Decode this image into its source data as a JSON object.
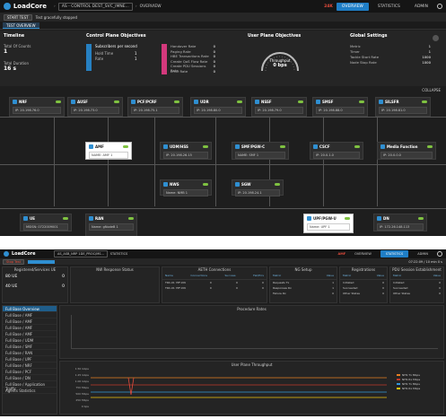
{
  "app": {
    "name": "LoadCore"
  },
  "s1": {
    "breadcrumb": {
      "session": "AS - CONTROL DEST_SVC_IMNE...",
      "page": "OVERVIEW"
    },
    "topright": {
      "alerts": "24K",
      "tabs": [
        "OVERVIEW",
        "STATISTICS",
        "ADMIN"
      ]
    },
    "subbar": {
      "button": "START TEST",
      "status": "Test gracefully stopped"
    },
    "tab": "TEST OVERVIEW",
    "timeline": {
      "title": "Timeline",
      "loops_label": "Total Of Counts",
      "loops": "1",
      "duration_label": "Total Duration",
      "duration": "16 s"
    },
    "cp": {
      "title": "Control Plane Objectives",
      "subs_label": "Subscribers per second",
      "hold_label": "Hold Time",
      "hold": "1",
      "rate_label": "Rate",
      "rate": "1",
      "rows": [
        {
          "k": "Handover Rate",
          "v": "0"
        },
        {
          "k": "Paging Rate",
          "v": "0"
        },
        {
          "k": "HBE Transactions Rate",
          "v": "0"
        },
        {
          "k": "Create QoS Flow Rate",
          "v": "0"
        },
        {
          "k": "Create PDU Sessions Rate",
          "v": "0"
        },
        {
          "k": "Error Rate",
          "v": "0"
        }
      ]
    },
    "up": {
      "title": "User Plane Objectives",
      "gauge_label": "Throughput",
      "gauge_value": "0 bps"
    },
    "gs": {
      "title": "Global Settings",
      "rows": [
        {
          "k": "Metric",
          "v": "1"
        },
        {
          "k": "Timer",
          "v": "1"
        },
        {
          "k": "Tackle Start Rate",
          "v": "1000"
        },
        {
          "k": "Node Stop Rate",
          "v": "1000"
        }
      ]
    },
    "collapse": "COLLAPSE",
    "nfs": [
      {
        "name": "NRF",
        "ip": "IP: 20.198.76.0"
      },
      {
        "name": "AUSF",
        "ip": "IP: 20.198.73.0"
      },
      {
        "name": "PCF/PCRF",
        "ip": "IP: 20.198.75.1"
      },
      {
        "name": "UDR",
        "ip": "IP: 20.198.80.0"
      },
      {
        "name": "NSSF",
        "ip": "IP: 20.198.79.0"
      },
      {
        "name": "SMSF",
        "ip": "IP: 20.198.88.0"
      },
      {
        "name": "SILSFR",
        "ip": "IP: 20.198.81.0"
      }
    ],
    "mid": [
      {
        "name": "AMF",
        "ip": "NAME: AMF 1"
      },
      {
        "name": "UDM/HSS",
        "ip": "IP: 20.198.26.15"
      },
      {
        "name": "SMF/PGW-C",
        "ip": "NAME: SMF 1"
      },
      {
        "name": "CSCF",
        "ip": "IP: 20.0.1.0"
      },
      {
        "name": "Media Function",
        "ip": "IP: 20.0.0.0"
      },
      {
        "name": "NWS",
        "ip": "Name: NMB 1"
      },
      {
        "name": "SGW",
        "ip": "IP: 20.198.24.1"
      }
    ],
    "bottom": [
      {
        "name": "UE",
        "ip": "MSISN: 0722009001"
      },
      {
        "name": "RAN",
        "ip": "Name: gNodeB 1"
      },
      {
        "name": "UPF/PGW-U",
        "ip": "Name: UPF 1"
      },
      {
        "name": "DN",
        "ip": "IP: 172.26.148.113"
      }
    ]
  },
  "s2": {
    "crumb": "AS_ASB_NRP 1DE_PROC/MS...",
    "page": "STATISTICS",
    "alerts": "AMF",
    "tabs": [
      "OVERVIEW",
      "STATISTICS",
      "ADMIN"
    ],
    "stopbtn": "Stop Test",
    "time": "07:22:09 / 10 min 0 s",
    "cards": [
      {
        "title": "Registered/Services UE",
        "a": "80 UE",
        "av": "0",
        "b": "40 UE",
        "bv": "0"
      },
      {
        "title": "NW Response Status"
      },
      {
        "title": "AETH Connections",
        "cols": [
          "Name",
          "Connections",
          "Success",
          "Fail/Errs"
        ],
        "rows": [
          [
            "TRC-01 YPF-DN",
            "0",
            "0",
            "0"
          ],
          [
            "TRC-01 YPF-DN",
            "0",
            "0",
            "0"
          ]
        ]
      },
      {
        "title": "NG Setup",
        "cols": [
          "Metric",
          "Value"
        ],
        "rows": [
          [
            "Requests Tx",
            "1"
          ],
          [
            "Responses Rx",
            "1"
          ],
          [
            "Failure Rx",
            "0"
          ]
        ]
      },
      {
        "title": "Registrations",
        "cols": [
          "Metric",
          "Value"
        ],
        "rows": [
          [
            "Initiated",
            "0"
          ],
          [
            "Succeeded",
            "0"
          ],
          [
            "Other States",
            "0"
          ]
        ]
      },
      {
        "title": "PDU Session Establishment",
        "cols": [
          "Metric",
          "Value"
        ],
        "rows": [
          [
            "Initiated",
            "0"
          ],
          [
            "Succeeded",
            "0"
          ],
          [
            "Other States",
            "0"
          ]
        ]
      }
    ],
    "side": [
      "Full Base Overview",
      "Full Base / AMF",
      "Full Base / AMF",
      "Full Base / AMF",
      "Full Base / AMF",
      "Full Base / UDM",
      "Full Base / SMF",
      "Full Base / RAN",
      "Full Base / UPF",
      "Full Base / NRF",
      "Full Base / PCF",
      "Full Base / DN",
      "Full Base / Application Traffic",
      "Agents Statistics"
    ],
    "chart1": {
      "title": "Procedure Rates"
    },
    "chart2": {
      "title": "User Plane Throughput"
    },
    "legend": [
      "NHS Tx Mbps",
      "NHS Rx Mbps",
      "NHS Tx Mbps",
      "NHS Rx Mbps"
    ],
    "yticks": [
      "1.50 Gbps",
      "1.25 Gbps",
      "1.00 Gbps",
      "750 Mbps",
      "500 Mbps",
      "250 Mbps",
      "0 bps"
    ]
  }
}
